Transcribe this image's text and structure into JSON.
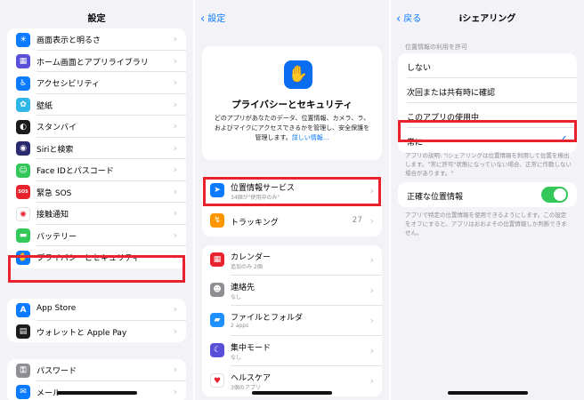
{
  "panel1": {
    "title": "設定",
    "group_a": [
      {
        "label": "画面表示と明るさ",
        "icon": "display-icon",
        "glyph": "☀",
        "color": "#0a7aff"
      },
      {
        "label": "ホーム画面とアプリライブラリ",
        "icon": "home-screen-icon",
        "glyph": "▦",
        "color": "#5a4fd8"
      },
      {
        "label": "アクセシビリティ",
        "icon": "accessibility-icon",
        "glyph": "♿",
        "color": "#0a7aff"
      },
      {
        "label": "壁紙",
        "icon": "wallpaper-icon",
        "glyph": "✿",
        "color": "#2fb6e8"
      },
      {
        "label": "スタンバイ",
        "icon": "standby-icon",
        "glyph": "◐",
        "color": "#1c1c1e"
      },
      {
        "label": "Siriと検索",
        "icon": "siri-icon",
        "glyph": "◉",
        "color": "#2a2a6e"
      },
      {
        "label": "Face IDとパスコード",
        "icon": "faceid-icon",
        "glyph": "☺",
        "color": "#34c759"
      },
      {
        "label": "緊急 SOS",
        "icon": "sos-icon",
        "glyph": "SOS",
        "color": "#e8232d"
      },
      {
        "label": "接触通知",
        "icon": "exposure-icon",
        "glyph": "✺",
        "color": "#ffffff"
      },
      {
        "label": "バッテリー",
        "icon": "battery-icon",
        "glyph": "▬",
        "color": "#34c759"
      },
      {
        "label": "プライバシーとセキュリティ",
        "icon": "privacy-hand-icon",
        "glyph": "✋",
        "color": "#0a7aff"
      }
    ],
    "group_b": [
      {
        "label": "App Store",
        "icon": "app-store-icon",
        "glyph": "A",
        "color": "#0a7aff"
      },
      {
        "label": "ウォレットと Apple Pay",
        "icon": "wallet-icon",
        "glyph": "▤",
        "color": "#1c1c1e"
      }
    ],
    "group_c": [
      {
        "label": "パスワード",
        "icon": "key-icon",
        "glyph": "⚿",
        "color": "#8e8e93"
      },
      {
        "label": "メール",
        "icon": "mail-icon",
        "glyph": "✉",
        "color": "#0a7aff"
      }
    ]
  },
  "panel2": {
    "back": "設定",
    "card_title": "プライバシーとセキュリティ",
    "card_desc": "どのアプリがあなたのデータ、位置情報、カメラ、ラ、およびマイクにアクセスできるかを管理し、安全保護を管理します。",
    "card_link": "詳しい情報...",
    "group_a": [
      {
        "label": "位置情報サービス",
        "sub": "34個が\"使用中のみ\"",
        "icon": "location-arrow-icon",
        "glyph": "➤",
        "color": "#0a7aff",
        "count": ""
      },
      {
        "label": "トラッキング",
        "sub": "",
        "icon": "tracking-icon",
        "glyph": "↯",
        "color": "#ff9500",
        "count": "27"
      }
    ],
    "group_b": [
      {
        "label": "カレンダー",
        "sub": "追加のみ 2個",
        "icon": "calendar-icon",
        "glyph": "▦",
        "color": "#e8232d"
      },
      {
        "label": "連絡先",
        "sub": "なし",
        "icon": "contacts-icon",
        "glyph": "☻",
        "color": "#8e8e93"
      },
      {
        "label": "ファイルとフォルダ",
        "sub": "2 apps",
        "icon": "folder-icon",
        "glyph": "▰",
        "color": "#1e90ff"
      },
      {
        "label": "集中モード",
        "sub": "なし",
        "icon": "focus-moon-icon",
        "glyph": "☾",
        "color": "#5a4fd8"
      },
      {
        "label": "ヘルスケア",
        "sub": "3個のアプリ",
        "icon": "health-heart-icon",
        "glyph": "♥",
        "color": "#ffffff"
      }
    ]
  },
  "panel3": {
    "back": "戻る",
    "title": "iシェアリング",
    "section_header": "位置情報の利用を許可",
    "options": [
      {
        "label": "しない",
        "checked": false
      },
      {
        "label": "次回または共有時に確認",
        "checked": false
      },
      {
        "label": "このアプリの使用中",
        "checked": false
      },
      {
        "label": "常に",
        "checked": true
      }
    ],
    "check_glyph": "✓",
    "options_footer": "アプリの説明: \"iシェアリングは位置情報を利用して位置を検出します。\"常に許可\"状態になっていない場合、正常に作動しない場合があります。\"",
    "precise_label": "正確な位置情報",
    "precise_on": true,
    "precise_footer": "アプリで特定の位置情報を使用できるようにします。この設定をオフにすると、アプリはおおよその位置情報しか判断できません。"
  },
  "colors": {
    "accent": "#0a7aff",
    "highlight": "#e8232d",
    "toggle_on": "#34c759"
  }
}
